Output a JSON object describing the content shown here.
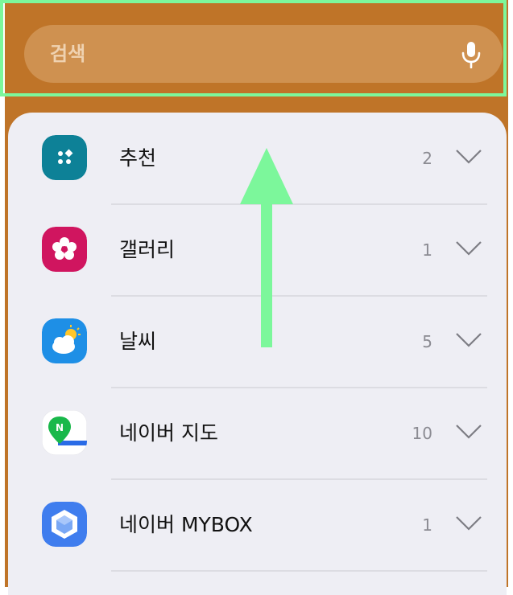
{
  "search": {
    "placeholder": "검색"
  },
  "apps": [
    {
      "label": "추천",
      "count": "2",
      "icon": "recommend-icon"
    },
    {
      "label": "갤러리",
      "count": "1",
      "icon": "gallery-flower-icon"
    },
    {
      "label": "날씨",
      "count": "5",
      "icon": "weather-cloud-sun-icon"
    },
    {
      "label": "네이버 지도",
      "count": "10",
      "icon": "naver-map-pin-icon"
    },
    {
      "label": "네이버 MYBOX",
      "count": "1",
      "icon": "naver-mybox-icon"
    }
  ],
  "colors": {
    "background": "#bf7428",
    "search_bar": "#cf9150",
    "panel": "#eeeef4",
    "highlight": "#7cf79b",
    "arrow": "#7cf79b"
  }
}
